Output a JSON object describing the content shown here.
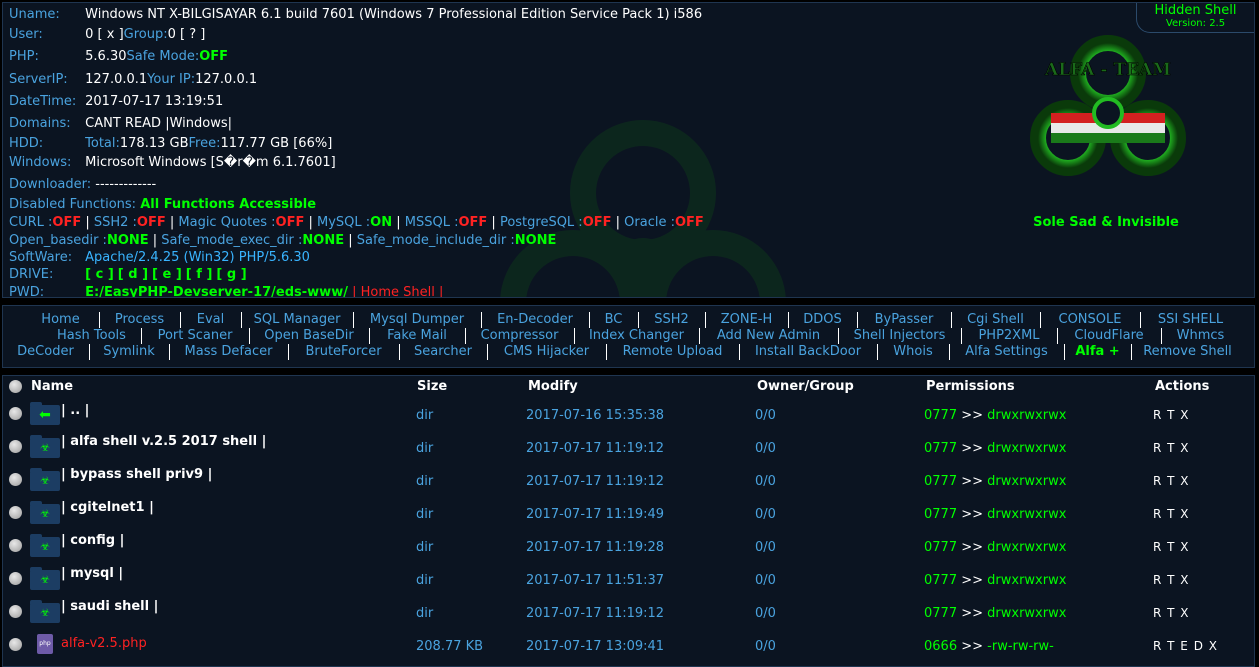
{
  "info": {
    "uname_label": "Uname:",
    "uname_value": "Windows NT X-BILGISAYAR 6.1 build 7601 (Windows 7 Professional Edition Service Pack 1) i586",
    "user_label": "User:",
    "user_value": "0 [ x ]",
    "group_label": " Group: ",
    "group_value": "0 [ ? ]",
    "php_label": "PHP:",
    "php_value": "5.6.30",
    "safe_mode_label": " Safe Mode: ",
    "safe_mode_value": "OFF",
    "server_ip_label": "ServerIP:",
    "server_ip_value": "127.0.0.1",
    "your_ip_label": " Your IP: ",
    "your_ip_value": "127.0.0.1",
    "datetime_label": "DateTime:",
    "datetime_value": "2017-07-17 13:19:51",
    "domains_label": "Domains:",
    "domains_value": "CANT READ |Windows|",
    "hdd_label": "HDD:",
    "hdd_total_label": "Total:",
    "hdd_total_value": "178.13 GB",
    "hdd_free_label": " Free:",
    "hdd_free_value": "117.77 GB [66%]",
    "windows_label": "Windows:",
    "windows_value": "Microsoft Windows [S�r�m 6.1.7601]",
    "downloader_label": "Downloader:",
    "downloader_value": " -------------",
    "disabled_label": "Disabled Functions:",
    "disabled_value": "All Functions Accessible",
    "curl_label": "CURL : ",
    "curl_value": "OFF",
    "ssh2_label": "SSH2 : ",
    "ssh2_value": "OFF",
    "magic_label": "Magic Quotes : ",
    "magic_value": "OFF",
    "mysql_label": "MySQL : ",
    "mysql_value": "ON",
    "mssql_label": "MSSQL : ",
    "mssql_value": "OFF",
    "postgres_label": "PostgreSQL : ",
    "postgres_value": "OFF",
    "oracle_label": "Oracle : ",
    "oracle_value": "OFF",
    "pipe": " | ",
    "openbase_label": "Open_basedir : ",
    "openbase_value": "NONE",
    "safe_exec_label": "Safe_mode_exec_dir : ",
    "safe_exec_value": "NONE",
    "safe_include_label": "Safe_mode_include_dir : ",
    "safe_include_value": "NONE",
    "software_label": "SoftWare:",
    "software_value": "Apache/2.4.25 (Win32) PHP/5.6.30",
    "drive_label": "DRIVE:",
    "drives": [
      "[ c ]",
      "[ d ]",
      "[ e ]",
      "[ f ]",
      "[ g ]"
    ],
    "pwd_label": "PWD:",
    "pwd_value": "E:/EasyPHP-Devserver-17/eds-www/",
    "home_shell": " | Home Shell |"
  },
  "hidden": {
    "title": "Hidden Shell",
    "version": "Version: 2.5"
  },
  "logo_text": "ALFA - TEAM",
  "tagline": "Sole Sad & Invisible",
  "menu": {
    "row1": [
      "Home",
      "Process",
      "Eval",
      "SQL Manager",
      "Mysql Dumper",
      "En-Decoder",
      "BC",
      "SSH2",
      "ZONE-H",
      "DDOS",
      "ByPasser",
      "Cgi Shell",
      "CONSOLE",
      "SSI SHELL"
    ],
    "row2": [
      "Hash Tools",
      "Port Scaner",
      "Open BaseDir",
      "Fake Mail",
      "Compressor",
      "Index Changer",
      "Add New Admin",
      "Shell Injectors",
      "PHP2XML",
      "CloudFlare",
      "Whmcs"
    ],
    "row3": [
      "DeCoder",
      "Symlink",
      "Mass Defacer",
      "BruteForcer",
      "Searcher",
      "CMS Hijacker",
      "Remote Upload",
      "Install BackDoor",
      "Whois",
      "Alfa Settings",
      "Alfa +",
      "Remove Shell"
    ]
  },
  "table": {
    "headers": {
      "name": "Name",
      "size": "Size",
      "modify": "Modify",
      "owner": "Owner/Group",
      "perms": "Permissions",
      "actions": "Actions"
    },
    "rows": [
      {
        "name": "| .. |",
        "type": "up",
        "size": "dir",
        "modify": "2017-07-16 15:35:38",
        "owner": "0/0",
        "perm_num": "0777",
        "perm_str": "drwxrwxrwx",
        "actions": "R T X"
      },
      {
        "name": "| alfa shell v.2.5 2017 shell |",
        "type": "dir",
        "size": "dir",
        "modify": "2017-07-17 11:19:12",
        "owner": "0/0",
        "perm_num": "0777",
        "perm_str": "drwxrwxrwx",
        "actions": "R T X"
      },
      {
        "name": "| bypass shell priv9 |",
        "type": "dir",
        "size": "dir",
        "modify": "2017-07-17 11:19:12",
        "owner": "0/0",
        "perm_num": "0777",
        "perm_str": "drwxrwxrwx",
        "actions": "R T X"
      },
      {
        "name": "| cgitelnet1 |",
        "type": "dir",
        "size": "dir",
        "modify": "2017-07-17 11:19:49",
        "owner": "0/0",
        "perm_num": "0777",
        "perm_str": "drwxrwxrwx",
        "actions": "R T X"
      },
      {
        "name": "| config |",
        "type": "dir",
        "size": "dir",
        "modify": "2017-07-17 11:19:28",
        "owner": "0/0",
        "perm_num": "0777",
        "perm_str": "drwxrwxrwx",
        "actions": "R T X"
      },
      {
        "name": "| mysql |",
        "type": "dir",
        "size": "dir",
        "modify": "2017-07-17 11:51:37",
        "owner": "0/0",
        "perm_num": "0777",
        "perm_str": "drwxrwxrwx",
        "actions": "R T X"
      },
      {
        "name": "| saudi shell |",
        "type": "dir",
        "size": "dir",
        "modify": "2017-07-17 11:19:12",
        "owner": "0/0",
        "perm_num": "0777",
        "perm_str": "drwxrwxrwx",
        "actions": "R T X"
      },
      {
        "name": "alfa-v2.5.php",
        "type": "php",
        "size": "208.77 KB",
        "modify": "2017-07-17 13:09:41",
        "owner": "0/0",
        "perm_num": "0666",
        "perm_str": "-rw-rw-rw-",
        "actions": "R T E D X"
      }
    ],
    "perm_arrow": " >> "
  },
  "colors": {
    "panel": "#0b1421",
    "label": "#4aa3df",
    "green": "#00ff00",
    "red": "#ff2222"
  }
}
